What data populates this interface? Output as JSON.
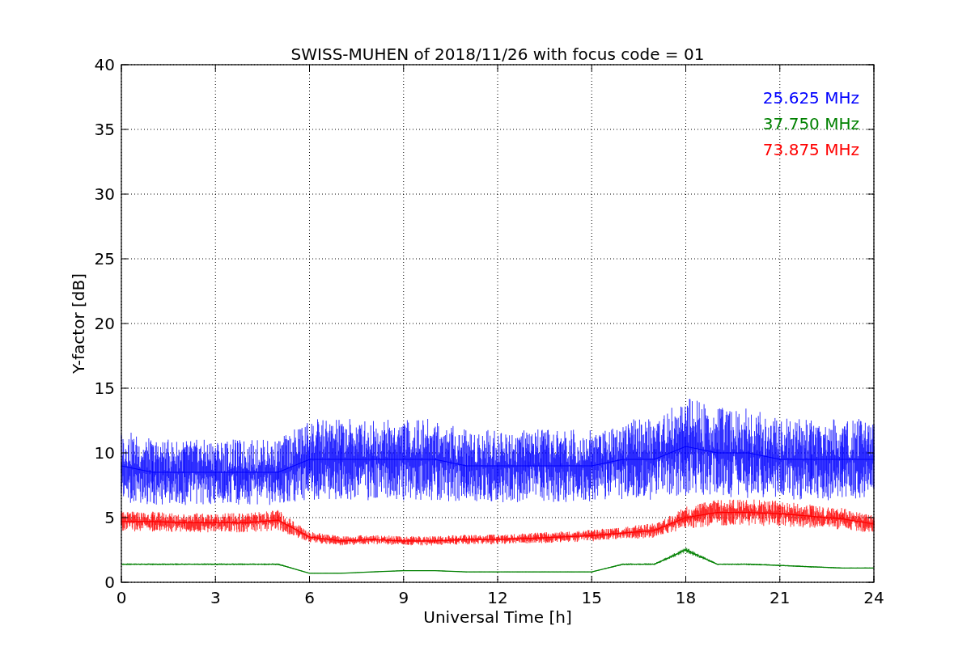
{
  "figure": {
    "chart_data": {
      "type": "line",
      "title": "SWISS-MUHEN of 2018/11/26 with focus code = 01",
      "xlabel": "Universal Time [h]",
      "ylabel": "Y-factor [dB]",
      "x": [
        0,
        1,
        2,
        3,
        4,
        5,
        6,
        7,
        8,
        9,
        10,
        11,
        12,
        13,
        14,
        15,
        16,
        17,
        18,
        19,
        20,
        21,
        22,
        23,
        24
      ],
      "series": [
        {
          "name": "25.625 MHz",
          "color": "#0000ff",
          "values": [
            9,
            8.5,
            8.5,
            8.5,
            8.5,
            8.5,
            9.5,
            9.5,
            9.5,
            9.5,
            9.5,
            9,
            9,
            9,
            9,
            9,
            9.5,
            9.5,
            10.5,
            10,
            10,
            9.5,
            9.5,
            9.5,
            9.5
          ]
        },
        {
          "name": "37.750 MHz",
          "color": "#008000",
          "values": [
            1.4,
            1.4,
            1.4,
            1.4,
            1.4,
            1.4,
            0.7,
            0.7,
            0.8,
            0.9,
            0.9,
            0.8,
            0.8,
            0.8,
            0.8,
            0.8,
            1.4,
            1.4,
            2.5,
            1.4,
            1.4,
            1.3,
            1.2,
            1.1,
            1.1
          ]
        },
        {
          "name": "73.875 MHz",
          "color": "#ff0000",
          "values": [
            4.7,
            4.7,
            4.6,
            4.6,
            4.6,
            4.8,
            3.5,
            3.2,
            3.3,
            3.2,
            3.2,
            3.3,
            3.3,
            3.4,
            3.5,
            3.6,
            3.8,
            4,
            5,
            5.4,
            5.4,
            5.3,
            5.1,
            4.9,
            4.5
          ]
        }
      ],
      "grid": true,
      "xlim": [
        0,
        24
      ],
      "ylim": [
        0,
        40
      ],
      "xticks": [
        0,
        3,
        6,
        9,
        12,
        15,
        18,
        21,
        24
      ],
      "yticks": [
        0,
        5,
        10,
        15,
        20,
        25,
        30,
        35,
        40
      ]
    }
  }
}
